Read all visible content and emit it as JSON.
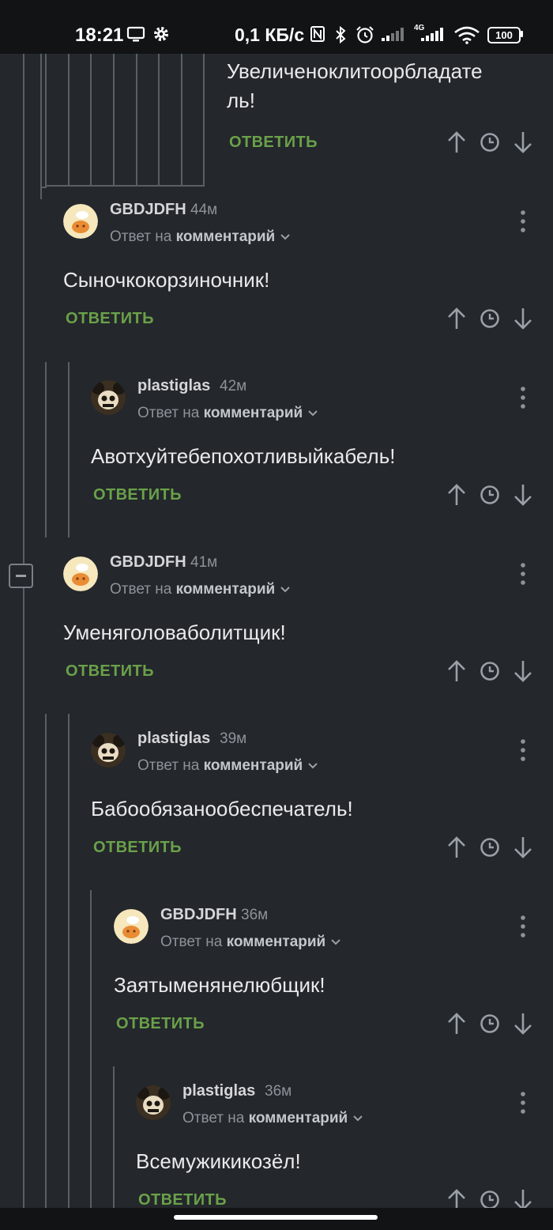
{
  "status_bar": {
    "time": "18:21",
    "network_speed": "0,1 КБ/с",
    "signal_label": "4G",
    "battery": "100"
  },
  "reply_to_prefix": "Ответ на",
  "reply_to_target": "комментарий",
  "reply_label": "ОТВЕТИТЬ",
  "colors": {
    "background": "#24272b",
    "reply_green": "#6aa14a",
    "meta_gray": "#8d939a",
    "thread_line": "#5a5f66"
  },
  "comments": [
    {
      "body": "Увеличеноклиторобладатель!",
      "body_lines": [
        "Увеличеноклитоорбладате",
        "ль!"
      ]
    },
    {
      "user": "GBDJDFH",
      "time": "44м",
      "body": "Сыночкокорзиночник!"
    },
    {
      "user": "plastiglas",
      "time": "42м",
      "body": "Авотхуйтебепохотливыйкабель!"
    },
    {
      "user": "GBDJDFH",
      "time": "41м",
      "body": "Уменяголоваболитщик!"
    },
    {
      "user": "plastiglas",
      "time": "39м",
      "body": "Бабообязанообеспечатель!"
    },
    {
      "user": "GBDJDFH",
      "time": "36м",
      "body": "Заятыменянелюбщик!"
    },
    {
      "user": "plastiglas",
      "time": "36м",
      "body": "Всемужикикозёл!"
    }
  ],
  "icons": {
    "upvote": "arrow-up-icon",
    "history": "clock-icon",
    "downvote": "arrow-down-icon",
    "more": "more-vertical-icon",
    "collapse": "minus-square-icon"
  }
}
